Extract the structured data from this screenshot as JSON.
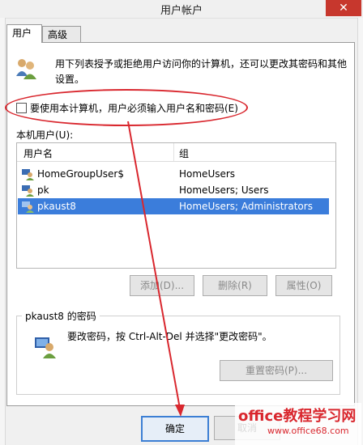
{
  "window": {
    "title": "用户帐户",
    "close_glyph": "✕"
  },
  "tabs": [
    {
      "label": "用户"
    },
    {
      "label": "高级"
    }
  ],
  "intro": {
    "text": "用下列表授予或拒绝用户访问你的计算机，还可以更改其密码和其他设置。"
  },
  "must_login": {
    "label": "要使用本计算机，用户必须输入用户名和密码(E)",
    "checked": false
  },
  "list": {
    "label": "本机用户(U):",
    "columns": {
      "name": "用户名",
      "group": "组"
    },
    "rows": [
      {
        "name": "HomeGroupUser$",
        "group": "HomeUsers"
      },
      {
        "name": "pk",
        "group": "HomeUsers; Users"
      },
      {
        "name": "pkaust8",
        "group": "HomeUsers; Administrators"
      }
    ]
  },
  "buttons": {
    "add": "添加(D)...",
    "remove": "删除(R)",
    "properties": "属性(O)",
    "ok": "确定",
    "cancel": "取消"
  },
  "password": {
    "title": "pkaust8 的密码",
    "text": "要改密码，按 Ctrl-Alt-Del 并选择\"更改密码\"。",
    "reset": "重置密码(P)..."
  },
  "watermark": {
    "title": "office教程学习网",
    "url": "www.office68.com"
  },
  "colors": {
    "selection": "#3b7ddb",
    "annotation": "#d9272e",
    "close": "#c7372d"
  }
}
